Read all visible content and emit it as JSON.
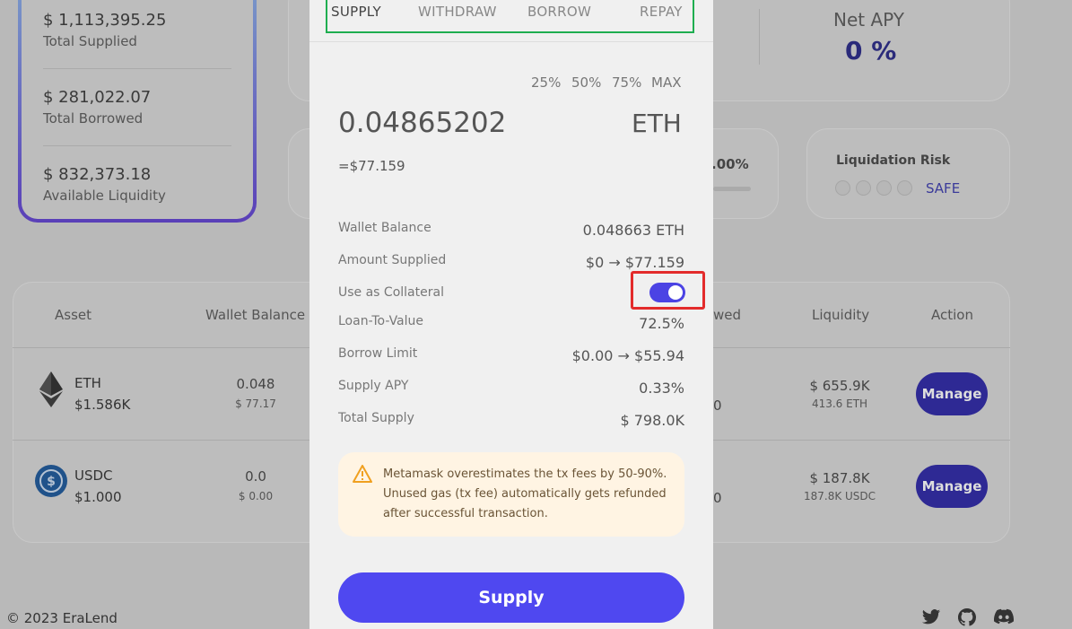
{
  "overview": {
    "total_supplied": {
      "value": "$ 1,113,395.25",
      "label": "Total Supplied"
    },
    "total_borrowed": {
      "value": "$ 281,022.07",
      "label": "Total Borrowed"
    },
    "available_liquidity": {
      "value": "$ 832,373.18",
      "label": "Available Liquidity"
    }
  },
  "net_apy": {
    "label": "Net APY",
    "value": "0 %"
  },
  "partial_percent": ".00%",
  "liquidation": {
    "title": "Liquidation Risk",
    "status": "SAFE"
  },
  "table": {
    "headers": {
      "asset": "Asset",
      "wallet_balance": "Wallet Balance",
      "borrowed_frag": "wed",
      "liquidity": "Liquidity",
      "action": "Action"
    },
    "rows": [
      {
        "name": "ETH",
        "price": "$1.586K",
        "wallet": "0.048",
        "wallet_usd": "$ 77.17",
        "frag": "0",
        "liquidity": "$ 655.9K",
        "liquidity_sub": "413.6 ETH",
        "action": "Manage"
      },
      {
        "name": "USDC",
        "price": "$1.000",
        "wallet": "0.0",
        "wallet_usd": "$ 0.00",
        "frag": "0",
        "liquidity": "$ 187.8K",
        "liquidity_sub": "187.8K USDC",
        "action": "Manage"
      }
    ]
  },
  "footer": {
    "copyright": "© 2023 EraLend"
  },
  "modal": {
    "tabs": [
      "SUPPLY",
      "WITHDRAW",
      "BORROW",
      "REPAY"
    ],
    "active_tab": "SUPPLY",
    "quick_amounts": [
      "25%",
      "50%",
      "75%",
      "MAX"
    ],
    "amount": "0.04865202",
    "token": "ETH",
    "usd_value": "=$77.159",
    "details": {
      "wallet_balance": {
        "label": "Wallet Balance",
        "value": "0.048663 ETH"
      },
      "amount_supplied": {
        "label": "Amount Supplied",
        "value": "$0 → $77.159"
      },
      "use_as_collateral": {
        "label": "Use as Collateral",
        "enabled": true
      },
      "ltv": {
        "label": "Loan-To-Value",
        "value": "72.5%"
      },
      "borrow_limit": {
        "label": "Borrow Limit",
        "value": "$0.00 → $55.94"
      },
      "supply_apy": {
        "label": "Supply APY",
        "value": "0.33%"
      },
      "total_supply": {
        "label": "Total Supply",
        "value": "$ 798.0K"
      }
    },
    "warning": "Metamask overestimates the tx fees by 50-90%. Unused gas (tx fee) automatically gets refunded after successful transaction.",
    "submit_label": "Supply"
  },
  "colors": {
    "accent": "#4f48f0",
    "toggle": "#4b43e4",
    "tab_highlight": "#1fae50",
    "collateral_highlight": "#e32b2b",
    "warning_bg": "#fff4e3"
  }
}
